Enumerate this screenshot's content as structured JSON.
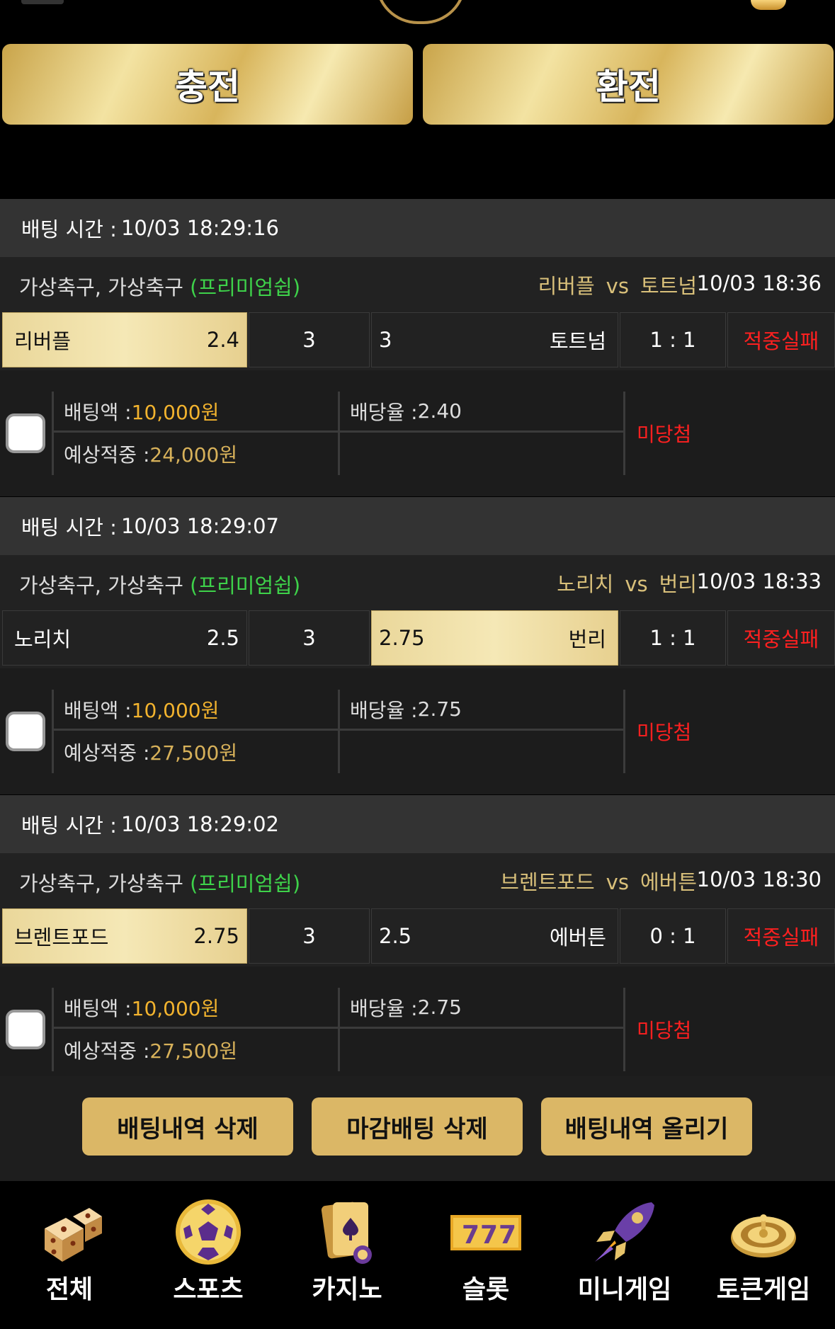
{
  "header": {
    "charge_label": "충전",
    "exchange_label": "환전"
  },
  "bets": [
    {
      "time_label": "배팅 시간 :",
      "time_value": "10/03 18:29:16",
      "league": "가상축구, 가상축구",
      "league_tag": "(프리미엄쉽)",
      "home": "리버플",
      "vs": "vs",
      "away": "토트넘",
      "game_time": "10/03 18:36",
      "home_odds": "2.4",
      "draw": "3",
      "away_odds": "3",
      "score": "1 : 1",
      "result": "적중실패",
      "selected": "home",
      "bet_amount_label": "배팅액 :",
      "bet_amount": "10,000원",
      "odds_label": "배당율 :",
      "odds_value": "2.40",
      "expected_label": "예상적중 :",
      "expected": "24,000원",
      "status": "미당첨"
    },
    {
      "time_label": "배팅 시간 :",
      "time_value": "10/03 18:29:07",
      "league": "가상축구, 가상축구",
      "league_tag": "(프리미엄쉽)",
      "home": "노리치",
      "vs": "vs",
      "away": "번리",
      "game_time": "10/03 18:33",
      "home_odds": "2.5",
      "draw": "3",
      "away_odds": "2.75",
      "score": "1 : 1",
      "result": "적중실패",
      "selected": "away",
      "bet_amount_label": "배팅액 :",
      "bet_amount": "10,000원",
      "odds_label": "배당율 :",
      "odds_value": "2.75",
      "expected_label": "예상적중 :",
      "expected": "27,500원",
      "status": "미당첨"
    },
    {
      "time_label": "배팅 시간 :",
      "time_value": "10/03 18:29:02",
      "league": "가상축구, 가상축구",
      "league_tag": "(프리미엄쉽)",
      "home": "브렌트포드",
      "vs": "vs",
      "away": "에버튼",
      "game_time": "10/03 18:30",
      "home_odds": "2.75",
      "draw": "3",
      "away_odds": "2.5",
      "score": "0 : 1",
      "result": "적중실패",
      "selected": "home",
      "bet_amount_label": "배팅액 :",
      "bet_amount": "10,000원",
      "odds_label": "배당율 :",
      "odds_value": "2.75",
      "expected_label": "예상적중 :",
      "expected": "27,500원",
      "status": "미당첨"
    }
  ],
  "actions": {
    "delete_label": "배팅내역 삭제",
    "close_delete_label": "마감배팅 삭제",
    "post_label": "배팅내역 올리기"
  },
  "nav": [
    {
      "label": "전체",
      "icon": "dice-icon"
    },
    {
      "label": "스포츠",
      "icon": "soccer-ball-icon"
    },
    {
      "label": "카지노",
      "icon": "cards-icon"
    },
    {
      "label": "슬롯",
      "icon": "slot-777-icon"
    },
    {
      "label": "미니게임",
      "icon": "rocket-icon"
    },
    {
      "label": "토큰게임",
      "icon": "roulette-icon"
    }
  ],
  "colors": {
    "gold_accent": "#dbb766",
    "win_fail_red": "#ff2020",
    "premium_green": "#3ed24a",
    "amount_gold": "#f2b32e"
  }
}
